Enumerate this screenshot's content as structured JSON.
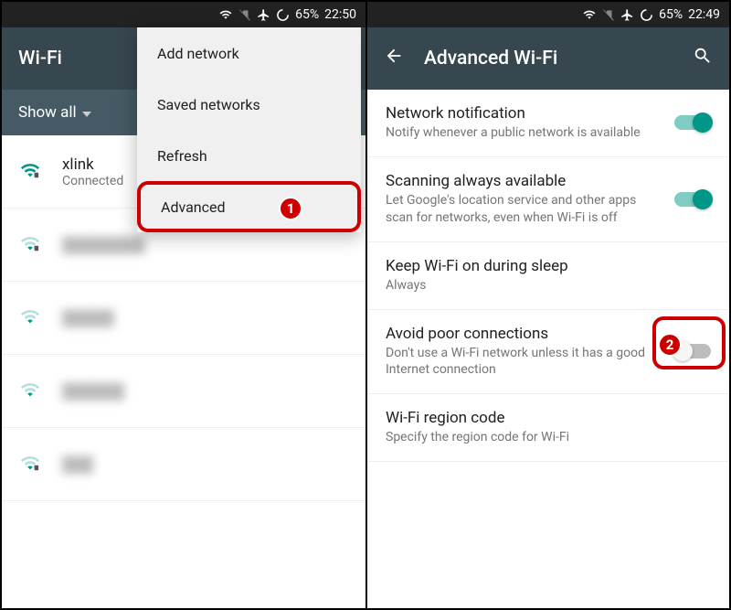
{
  "left": {
    "statusbar": {
      "battery": "65%",
      "time": "22:50"
    },
    "appbar_title": "Wi-Fi",
    "filter_label": "Show all",
    "networks": [
      {
        "ssid": "xlink",
        "status": "Connected",
        "secured": true,
        "strength": "full"
      },
      {
        "ssid": "——",
        "status": "",
        "secured": true,
        "strength": "weak",
        "blurred": true
      },
      {
        "ssid": "——",
        "status": "",
        "secured": false,
        "strength": "weak",
        "blurred": true
      },
      {
        "ssid": "——",
        "status": "",
        "secured": false,
        "strength": "weak",
        "blurred": true
      },
      {
        "ssid": "——",
        "status": "",
        "secured": true,
        "strength": "weak",
        "blurred": true
      }
    ],
    "menu": {
      "items": [
        "Add network",
        "Saved networks",
        "Refresh",
        "Advanced"
      ]
    },
    "callout_number": "1"
  },
  "right": {
    "statusbar": {
      "battery": "65%",
      "time": "22:49"
    },
    "appbar_title": "Advanced Wi-Fi",
    "settings": [
      {
        "title": "Network notification",
        "sub": "Notify whenever a public network is available",
        "toggle": "on"
      },
      {
        "title": "Scanning always available",
        "sub": "Let Google's location service and other apps scan for networks, even when Wi-Fi is off",
        "toggle": "on"
      },
      {
        "title": "Keep Wi-Fi on during sleep",
        "sub": "Always",
        "toggle": null
      },
      {
        "title": "Avoid poor connections",
        "sub": "Don't use a Wi-Fi network unless it has a good Internet connection",
        "toggle": "off"
      },
      {
        "title": "Wi-Fi region code",
        "sub": "Specify the region code for Wi-Fi",
        "toggle": null
      }
    ],
    "callout_number": "2"
  }
}
